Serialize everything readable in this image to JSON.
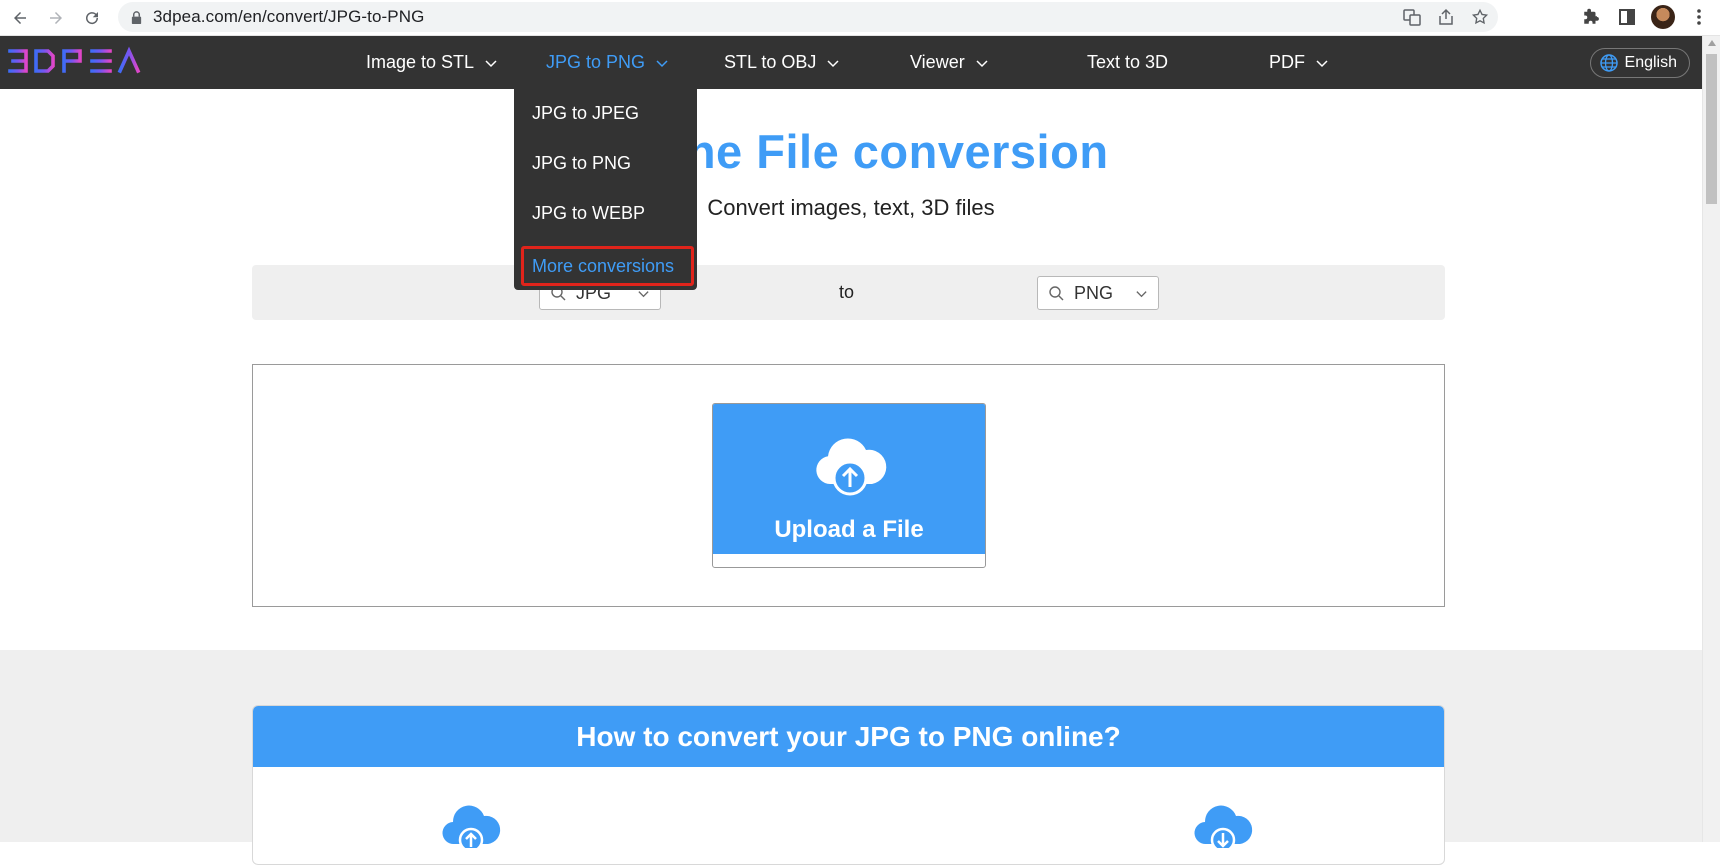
{
  "browser": {
    "url": "3dpea.com/en/convert/JPG-to-PNG"
  },
  "header": {
    "logo_text": "3DPEA",
    "nav": [
      {
        "label": "Image to STL",
        "has_menu": true
      },
      {
        "label": "JPG to PNG",
        "has_menu": true,
        "active": true
      },
      {
        "label": "STL to OBJ",
        "has_menu": true
      },
      {
        "label": "Viewer",
        "has_menu": true
      },
      {
        "label": "Text to 3D",
        "has_menu": false
      },
      {
        "label": "PDF",
        "has_menu": true
      }
    ],
    "language": "English"
  },
  "dropdown": {
    "items": [
      "JPG to JPEG",
      "JPG to PNG",
      "JPG to WEBP",
      "More conversions"
    ],
    "highlighted": "More conversions"
  },
  "hero": {
    "title": "Online File conversion",
    "subtitle": "Convert images, text, 3D files"
  },
  "converter": {
    "from_format": "JPG",
    "to_label": "to",
    "to_format": "PNG"
  },
  "upload": {
    "label": "Upload a File"
  },
  "howto": {
    "title": "How to convert your JPG to PNG online?"
  },
  "colors": {
    "accent": "#3f9cf6",
    "header_bg": "#333333",
    "highlight_border": "#e0241b"
  }
}
